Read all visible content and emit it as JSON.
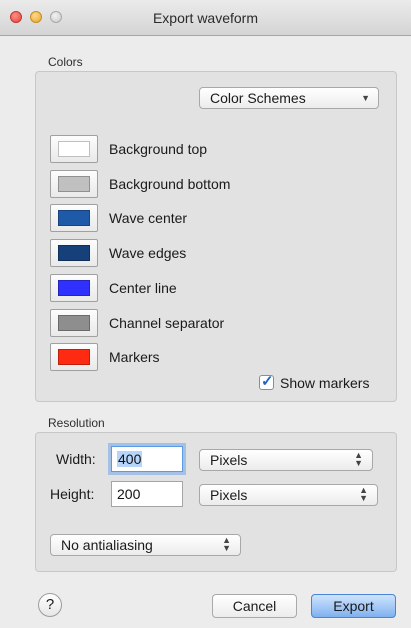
{
  "window": {
    "title": "Export waveform"
  },
  "colors_section": {
    "label": "Colors",
    "scheme_popup": "Color Schemes",
    "items": [
      {
        "label": "Background top",
        "color": "#ffffff"
      },
      {
        "label": "Background bottom",
        "color": "#c0c0c0"
      },
      {
        "label": "Wave center",
        "color": "#1f5aa9"
      },
      {
        "label": "Wave edges",
        "color": "#15407a"
      },
      {
        "label": "Center line",
        "color": "#3030ff"
      },
      {
        "label": "Channel separator",
        "color": "#8e8e8e"
      },
      {
        "label": "Markers",
        "color": "#ff2a12"
      }
    ],
    "show_markers": {
      "label": "Show markers",
      "checked": true
    }
  },
  "resolution_section": {
    "label": "Resolution",
    "width": {
      "label": "Width:",
      "value": "400",
      "unit": "Pixels"
    },
    "height": {
      "label": "Height:",
      "value": "200",
      "unit": "Pixels"
    },
    "antialiasing": "No antialiasing"
  },
  "footer": {
    "help": "?",
    "cancel": "Cancel",
    "export": "Export"
  },
  "accent_color": "#4b83d6"
}
